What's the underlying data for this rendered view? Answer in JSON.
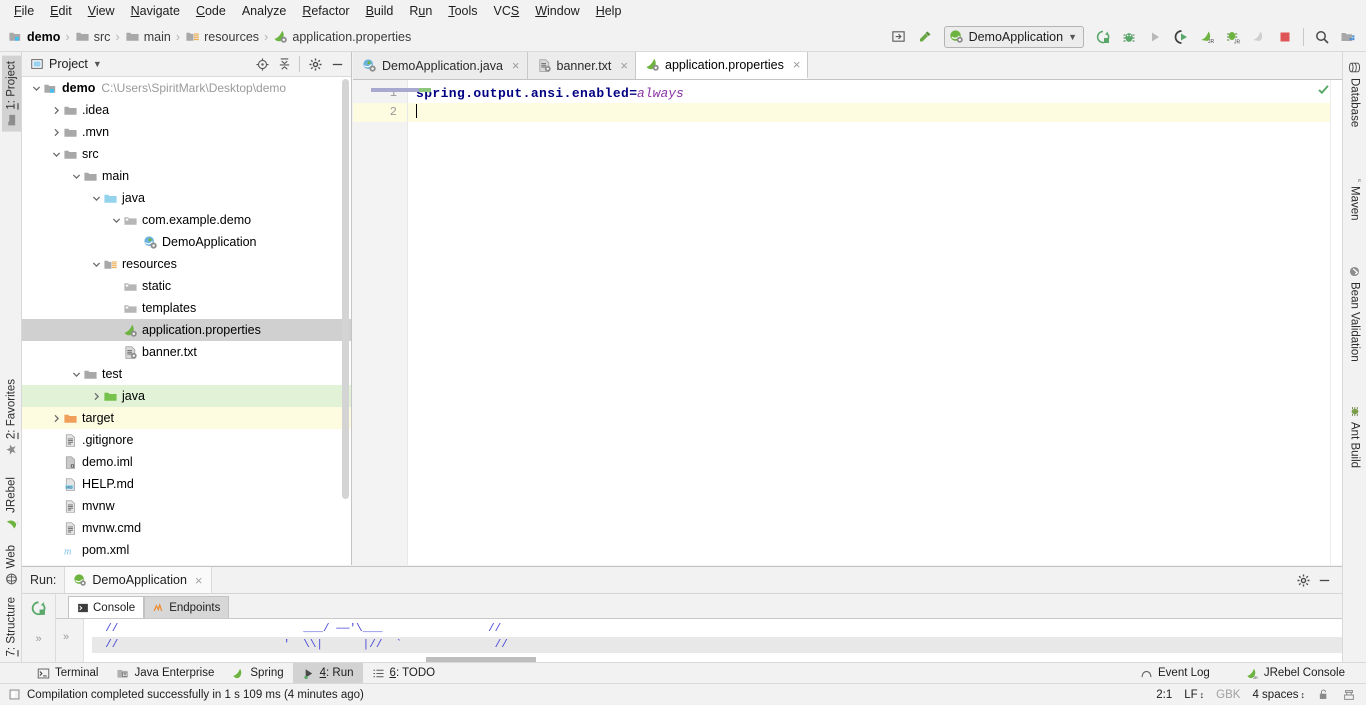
{
  "menu": {
    "items": [
      {
        "label": "File",
        "accel": "F"
      },
      {
        "label": "Edit",
        "accel": "E"
      },
      {
        "label": "View",
        "accel": "V"
      },
      {
        "label": "Navigate",
        "accel": "N"
      },
      {
        "label": "Code",
        "accel": "C"
      },
      {
        "label": "Analyze",
        "accel": ""
      },
      {
        "label": "Refactor",
        "accel": "R"
      },
      {
        "label": "Build",
        "accel": "B"
      },
      {
        "label": "Run",
        "accel": "u"
      },
      {
        "label": "Tools",
        "accel": "T"
      },
      {
        "label": "VCS",
        "accel": "S"
      },
      {
        "label": "Window",
        "accel": "W"
      },
      {
        "label": "Help",
        "accel": "H"
      }
    ]
  },
  "navbar": {
    "breadcrumbs": [
      {
        "label": "demo",
        "icon": "module-icon"
      },
      {
        "label": "src",
        "icon": "folder-icon"
      },
      {
        "label": "main",
        "icon": "folder-icon"
      },
      {
        "label": "resources",
        "icon": "resources-folder-icon"
      },
      {
        "label": "application.properties",
        "icon": "spring-properties-icon"
      }
    ],
    "separator": "›",
    "run_config": "DemoApplication",
    "toolbar_icons": [
      "select-in-icon",
      "hammer-build-icon",
      "run-icon",
      "debug-icon",
      "run-play-icon",
      "jrebel-run-icon",
      "jrebel-debug-icon",
      "jrebel-stop-icon",
      "stop-icon",
      "search-icon",
      "project-structure-icon"
    ]
  },
  "left_strip": {
    "tabs": [
      {
        "label": "1: Project",
        "accel": "1",
        "selected": true,
        "icon": "project-icon"
      },
      {
        "label": "2: Favorites",
        "accel": "2",
        "selected": false,
        "icon": "star-icon"
      },
      {
        "label": "JRebel",
        "accel": "",
        "selected": false,
        "icon": "jrebel-icon"
      },
      {
        "label": "Web",
        "accel": "",
        "selected": false,
        "icon": "web-globe-icon"
      },
      {
        "label": "7: Structure",
        "accel": "7",
        "selected": false,
        "icon": "structure-icon"
      }
    ]
  },
  "right_strip": {
    "tabs": [
      {
        "label": "Database",
        "icon": "database-icon"
      },
      {
        "label": "Maven",
        "icon": "maven-icon"
      },
      {
        "label": "Bean Validation",
        "icon": "bean-validation-icon"
      },
      {
        "label": "Ant Build",
        "icon": "ant-build-icon"
      }
    ]
  },
  "project_panel": {
    "title": "Project",
    "title_dropdown": "▾",
    "actions": [
      "locate-icon",
      "collapse-all-icon",
      "gear-icon",
      "hide-icon"
    ],
    "tree": [
      {
        "label": "demo",
        "path": "C:\\Users\\SpiritMark\\Desktop\\demo",
        "depth": 0,
        "arrow": "down",
        "icon": "module-icon",
        "bold": true,
        "state": ""
      },
      {
        "label": ".idea",
        "path": "",
        "depth": 1,
        "arrow": "right",
        "icon": "folder-icon",
        "bold": false,
        "state": ""
      },
      {
        "label": ".mvn",
        "path": "",
        "depth": 1,
        "arrow": "right",
        "icon": "folder-icon",
        "bold": false,
        "state": ""
      },
      {
        "label": "src",
        "path": "",
        "depth": 1,
        "arrow": "down",
        "icon": "folder-icon",
        "bold": false,
        "state": ""
      },
      {
        "label": "main",
        "path": "",
        "depth": 2,
        "arrow": "down",
        "icon": "folder-icon",
        "bold": false,
        "state": ""
      },
      {
        "label": "java",
        "path": "",
        "depth": 3,
        "arrow": "down",
        "icon": "source-folder-icon",
        "bold": false,
        "state": ""
      },
      {
        "label": "com.example.demo",
        "path": "",
        "depth": 4,
        "arrow": "down",
        "icon": "package-icon",
        "bold": false,
        "state": ""
      },
      {
        "label": "DemoApplication",
        "path": "",
        "depth": 5,
        "arrow": "none",
        "icon": "spring-class-icon",
        "bold": false,
        "state": ""
      },
      {
        "label": "resources",
        "path": "",
        "depth": 3,
        "arrow": "down",
        "icon": "resources-folder-icon",
        "bold": false,
        "state": ""
      },
      {
        "label": "static",
        "path": "",
        "depth": 4,
        "arrow": "none",
        "icon": "package-icon",
        "bold": false,
        "state": ""
      },
      {
        "label": "templates",
        "path": "",
        "depth": 4,
        "arrow": "none",
        "icon": "package-icon",
        "bold": false,
        "state": ""
      },
      {
        "label": "application.properties",
        "path": "",
        "depth": 4,
        "arrow": "none",
        "icon": "spring-properties-icon",
        "bold": false,
        "state": "sel"
      },
      {
        "label": "banner.txt",
        "path": "",
        "depth": 4,
        "arrow": "none",
        "icon": "banner-file-icon",
        "bold": false,
        "state": ""
      },
      {
        "label": "test",
        "path": "",
        "depth": 2,
        "arrow": "down",
        "icon": "folder-icon",
        "bold": false,
        "state": ""
      },
      {
        "label": "java",
        "path": "",
        "depth": 3,
        "arrow": "right",
        "icon": "test-source-folder-icon",
        "bold": false,
        "state": "green"
      },
      {
        "label": "target",
        "path": "",
        "depth": 1,
        "arrow": "right",
        "icon": "excluded-folder-icon",
        "bold": false,
        "state": "yellow"
      },
      {
        "label": ".gitignore",
        "path": "",
        "depth": 1,
        "arrow": "none",
        "icon": "text-file-icon",
        "bold": false,
        "state": ""
      },
      {
        "label": "demo.iml",
        "path": "",
        "depth": 1,
        "arrow": "none",
        "icon": "iml-file-icon",
        "bold": false,
        "state": ""
      },
      {
        "label": "HELP.md",
        "path": "",
        "depth": 1,
        "arrow": "none",
        "icon": "markdown-file-icon",
        "bold": false,
        "state": ""
      },
      {
        "label": "mvnw",
        "path": "",
        "depth": 1,
        "arrow": "none",
        "icon": "text-file-icon",
        "bold": false,
        "state": ""
      },
      {
        "label": "mvnw.cmd",
        "path": "",
        "depth": 1,
        "arrow": "none",
        "icon": "text-file-icon",
        "bold": false,
        "state": ""
      },
      {
        "label": "pom.xml",
        "path": "",
        "depth": 1,
        "arrow": "none",
        "icon": "maven-pom-icon",
        "bold": false,
        "state": ""
      }
    ]
  },
  "editor": {
    "tabs": [
      {
        "label": "DemoApplication.java",
        "icon": "spring-class-icon",
        "active": false,
        "close": "×"
      },
      {
        "label": "banner.txt",
        "icon": "banner-file-icon",
        "active": false,
        "close": "×"
      },
      {
        "label": "application.properties",
        "icon": "spring-properties-icon",
        "active": true,
        "close": "×"
      }
    ],
    "lines": [
      {
        "number": "1",
        "key": "spring.output.ansi.enabled",
        "sep": "=",
        "value": "always",
        "current": false
      },
      {
        "number": "2",
        "key": "",
        "sep": "",
        "value": "",
        "current": true
      }
    ],
    "inspection_status": "ok-checkmark-icon"
  },
  "run_panel": {
    "label": "Run:",
    "tab": "DemoApplication",
    "tab_icon": "spring-class-icon",
    "tab_close": "×",
    "actions": [
      "gear-icon",
      "hide-icon"
    ],
    "left_actions": [
      "rerun-icon"
    ],
    "sub_tabs": [
      {
        "label": "Console",
        "icon": "console-icon",
        "active": true
      },
      {
        "label": "Endpoints",
        "icon": "endpoints-icon",
        "active": false
      }
    ],
    "console_lines": [
      "  //                            ___/ ——'\\___                //",
      "  //                         '  \\\\|      |//  `              //"
    ],
    "expand_glyph": "»"
  },
  "bottom_strip": {
    "tabs": [
      {
        "label": "Terminal",
        "accel": "",
        "icon": "terminal-icon",
        "selected": false
      },
      {
        "label": "Java Enterprise",
        "accel": "",
        "icon": "java-enterprise-icon",
        "selected": false
      },
      {
        "label": "Spring",
        "accel": "",
        "icon": "spring-leaf-icon",
        "selected": false
      },
      {
        "label": "4: Run",
        "accel": "4",
        "icon": "run-green-icon",
        "selected": true
      },
      {
        "label": "6: TODO",
        "accel": "6",
        "icon": "todo-icon",
        "selected": false
      }
    ],
    "right_tabs": [
      {
        "label": "Event Log",
        "icon": "event-log-icon"
      },
      {
        "label": "JRebel Console",
        "icon": "jrebel-icon"
      }
    ]
  },
  "status_bar": {
    "message": "Compilation completed successfully in 1 s 109 ms (4 minutes ago)",
    "message_icon": "build-status-icon",
    "caret_position": "2:1",
    "line_separator": "LF",
    "line_separator_arrow": "↕",
    "encoding": "GBK",
    "indent": "4 spaces",
    "indent_arrow": "↕",
    "lock_icon": "unlocked-icon",
    "inspector_icon": "inspector-icon"
  }
}
